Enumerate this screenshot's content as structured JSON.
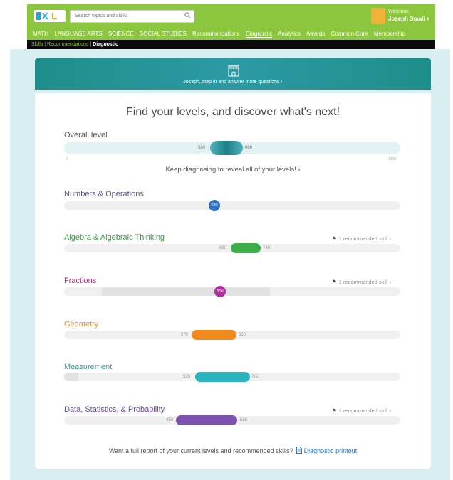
{
  "header": {
    "search_placeholder": "Search topics and skills",
    "welcome": "Welcome,",
    "user_name": "Joseph Small ▾",
    "nav": [
      "MATH",
      "LANGUAGE ARTS",
      "SCIENCE",
      "SOCIAL STUDIES",
      "Recommendations",
      "Diagnostic",
      "Analytics",
      "Awards",
      "Common Core",
      "Membership"
    ]
  },
  "breadcrumb": {
    "items": [
      "Skills",
      "Recommendations"
    ],
    "current": "Diagnostic",
    "separator": " | "
  },
  "banner": {
    "text": "Joseph, step in and answer more questions ›"
  },
  "main": {
    "heading": "Find your levels, and discover what's next!",
    "overall": {
      "label": "Overall level",
      "low": "580",
      "high": "660",
      "scale_min": "0",
      "scale_max": "1300",
      "keep_text": "Keep diagnosing to reveal all of your levels! ›"
    },
    "categories": [
      {
        "label": "Numbers & Operations",
        "value": "680",
        "color": "#2e6fc7",
        "rec": ""
      },
      {
        "label": "Algebra & Algebraic Thinking",
        "low": "660",
        "high": "740",
        "color": "#3dad4a",
        "rec": "1 recommended skill ›"
      },
      {
        "label": "Fractions",
        "value": "600",
        "color": "#b02e9b",
        "rec": "1 recommended skill ›"
      },
      {
        "label": "Geometry",
        "low": "570",
        "high": "650",
        "color": "#f08a1c",
        "rec": ""
      },
      {
        "label": "Measurement",
        "low": "520",
        "high": "702",
        "color": "#2bb4bf",
        "rec": ""
      },
      {
        "label": "Data, Statistics, & Probability",
        "low": "450",
        "high": "550",
        "color": "#7e53b0",
        "rec": "1 recommended skill ›"
      }
    ],
    "footer_text": "Want a full report of your current levels and recommended skills?",
    "footer_link": "Diagnostic printout"
  },
  "colors": {
    "green_bar": "#8cc63f",
    "banner_teal": "#1e8e8a",
    "background": "#d9eef0"
  }
}
